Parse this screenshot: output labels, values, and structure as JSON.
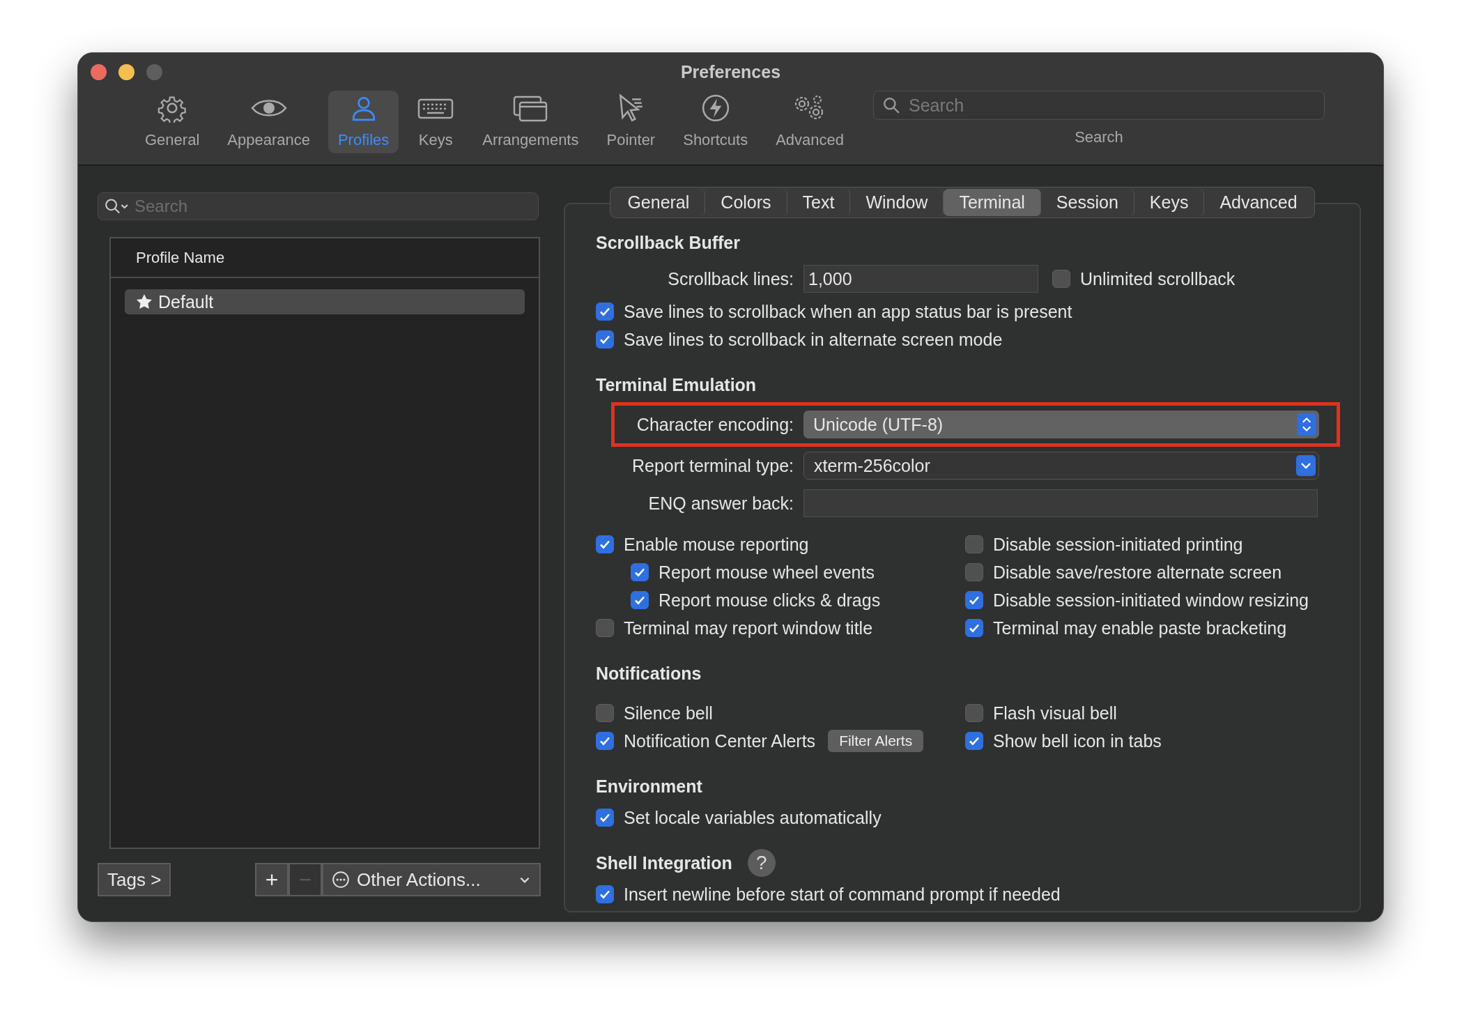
{
  "window": {
    "title": "Preferences"
  },
  "toolbar": {
    "items": [
      {
        "label": "General",
        "selected": false
      },
      {
        "label": "Appearance",
        "selected": false
      },
      {
        "label": "Profiles",
        "selected": true
      },
      {
        "label": "Keys",
        "selected": false
      },
      {
        "label": "Arrangements",
        "selected": false
      },
      {
        "label": "Pointer",
        "selected": false
      },
      {
        "label": "Shortcuts",
        "selected": false
      },
      {
        "label": "Advanced",
        "selected": false
      }
    ],
    "search": {
      "placeholder": "Search",
      "label": "Search"
    }
  },
  "profiles": {
    "search": {
      "placeholder": "Search"
    },
    "column": "Profile Name",
    "rows": [
      {
        "name": "Default",
        "selected": true
      }
    ],
    "tags_button": "Tags >",
    "add_button": {
      "label": "+",
      "disabled": false
    },
    "remove_button": {
      "label": "−",
      "disabled": true
    },
    "other_actions": "Other Actions..."
  },
  "tabs": [
    {
      "label": "General",
      "selected": false
    },
    {
      "label": "Colors",
      "selected": false
    },
    {
      "label": "Text",
      "selected": false
    },
    {
      "label": "Window",
      "selected": false
    },
    {
      "label": "Terminal",
      "selected": true
    },
    {
      "label": "Session",
      "selected": false
    },
    {
      "label": "Keys",
      "selected": false
    },
    {
      "label": "Advanced",
      "selected": false
    }
  ],
  "sections": [
    {
      "title": "Scrollback Buffer",
      "items": [
        {
          "kind": "field_check",
          "label": "Scrollback lines:",
          "value": "1,000",
          "checkbox": {
            "label": "Unlimited scrollback",
            "checked": false
          }
        },
        {
          "kind": "checkbox",
          "label": "Save lines to scrollback when an app status bar is present",
          "checked": true
        },
        {
          "kind": "checkbox",
          "label": "Save lines to scrollback in alternate screen mode",
          "checked": true
        }
      ]
    },
    {
      "title": "Terminal Emulation",
      "items": [
        {
          "kind": "popup",
          "label": "Character encoding:",
          "value": "Unicode (UTF-8)",
          "highlighted": true
        },
        {
          "kind": "combo",
          "label": "Report terminal type:",
          "value": "xterm-256color",
          "highlighted": false
        },
        {
          "kind": "field",
          "label": "ENQ answer back:"
        },
        {
          "kind": "columns",
          "columns": [
            [
              {
                "label": "Enable mouse reporting",
                "checked": true,
                "children": [
                  {
                    "label": "Report mouse wheel events",
                    "checked": true
                  },
                  {
                    "label": "Report mouse clicks & drags",
                    "checked": true
                  }
                ]
              },
              {
                "label": "Terminal may report window title",
                "checked": false
              }
            ],
            [
              {
                "label": "Disable session-initiated printing",
                "checked": false
              },
              {
                "label": "Disable save/restore alternate screen",
                "checked": false
              },
              {
                "label": "Disable session-initiated window resizing",
                "checked": true
              },
              {
                "label": "Terminal may enable paste bracketing",
                "checked": true
              }
            ]
          ]
        }
      ]
    },
    {
      "title": "Notifications",
      "items": [
        {
          "kind": "columns",
          "columns": [
            [
              {
                "label": "Silence bell",
                "checked": false
              },
              {
                "label": "Notification Center Alerts",
                "checked": true,
                "button": "Filter Alerts"
              }
            ],
            [
              {
                "label": "Flash visual bell",
                "checked": false
              },
              {
                "label": "Show bell icon in tabs",
                "checked": true
              }
            ]
          ]
        }
      ]
    },
    {
      "title": "Environment",
      "items": [
        {
          "kind": "checkbox",
          "label": "Set locale variables automatically",
          "checked": true
        }
      ]
    },
    {
      "title": "Shell Integration",
      "help": "?",
      "items": [
        {
          "kind": "checkbox",
          "label": "Insert newline before start of command prompt if needed",
          "checked": true
        }
      ]
    }
  ]
}
